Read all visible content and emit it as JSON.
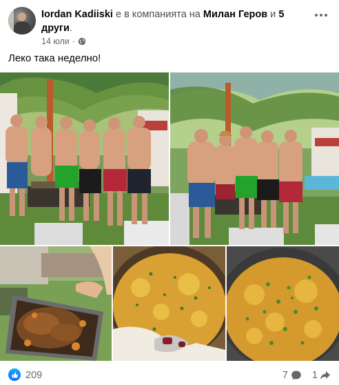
{
  "post": {
    "author": "Iordan Kadiiski",
    "with_text": "е в компанията на",
    "tagged": "Милан Геров",
    "and_text": "и",
    "others": "5 други",
    "period": ".",
    "date": "14 юли",
    "dot": "·",
    "text": "Леко така неделно!"
  },
  "footer": {
    "reactions": "209",
    "comments": "7",
    "shares": "1"
  },
  "icons": {
    "more": "ellipsis-icon",
    "privacy": "globe-icon",
    "like": "thumbs-up-icon",
    "comment": "comment-icon",
    "share": "share-icon"
  },
  "colors": {
    "accent": "#0866ff",
    "muted": "#65676b"
  }
}
